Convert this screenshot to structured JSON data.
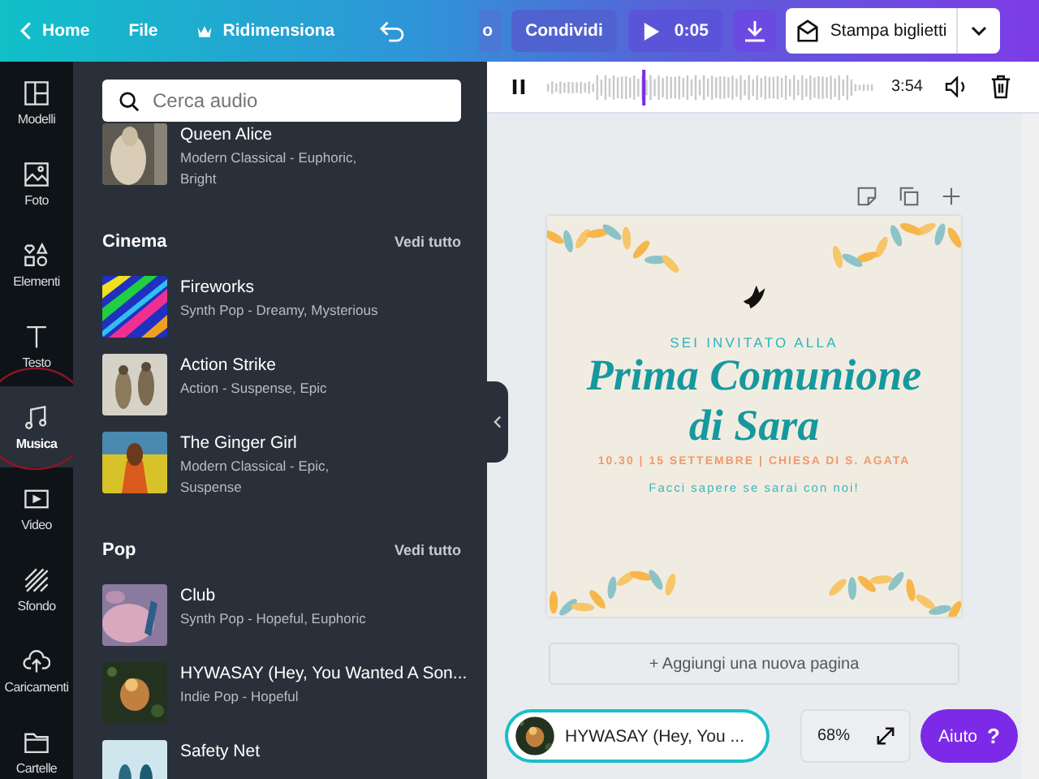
{
  "top_bar": {
    "home": "Home",
    "file": "File",
    "resize": "Ridimensiona",
    "cut_button": "o",
    "share": "Condividi",
    "play_time": "0:05",
    "print": "Stampa biglietti"
  },
  "sidebar": {
    "items": [
      {
        "label": "Modelli",
        "selected": false
      },
      {
        "label": "Foto",
        "selected": false
      },
      {
        "label": "Elementi",
        "selected": false
      },
      {
        "label": "Testo",
        "selected": false
      },
      {
        "label": "Musica",
        "selected": true
      },
      {
        "label": "Video",
        "selected": false
      },
      {
        "label": "Sfondo",
        "selected": false
      },
      {
        "label": "Caricamenti",
        "selected": false
      },
      {
        "label": "Cartelle",
        "selected": false
      }
    ]
  },
  "audio_panel": {
    "search": {
      "placeholder": "Cerca audio"
    },
    "sections": [
      {
        "tracks": [
          {
            "title": "Queen Alice",
            "subtitle": "Modern Classical - Euphoric, Bright"
          }
        ]
      },
      {
        "title": "Cinema",
        "link": "Vedi tutto",
        "tracks": [
          {
            "title": "Fireworks",
            "subtitle": "Synth Pop - Dreamy, Mysterious"
          },
          {
            "title": "Action Strike",
            "subtitle": "Action - Suspense, Epic"
          },
          {
            "title": "The Ginger Girl",
            "subtitle": "Modern Classical - Epic, Suspense"
          }
        ]
      },
      {
        "title": "Pop",
        "link": "Vedi tutto",
        "tracks": [
          {
            "title": "Club",
            "subtitle": "Synth Pop - Hopeful, Euphoric"
          },
          {
            "title": "HYWASAY (Hey, You Wanted A Son...",
            "subtitle": "Indie Pop - Hopeful"
          },
          {
            "title": "Safety Net"
          }
        ]
      }
    ]
  },
  "audio_bar": {
    "level": 0.29,
    "duration": "3:54"
  },
  "invite": {
    "intro": "SEI INVITATO ALLA",
    "title_lines": [
      "Prima Comunione",
      "di Sara"
    ],
    "details": "10.30 | 15 SETTEMBRE | CHIESA DI S. AGATA",
    "note": "Facci sapere se sarai con noi!"
  },
  "add_page": "+ Aggiungi una nuova pagina",
  "now_playing": {
    "title": "HYWASAY (Hey, You ..."
  },
  "zoom": "68%",
  "help": {
    "label": "Aiuto",
    "icon": "?"
  }
}
